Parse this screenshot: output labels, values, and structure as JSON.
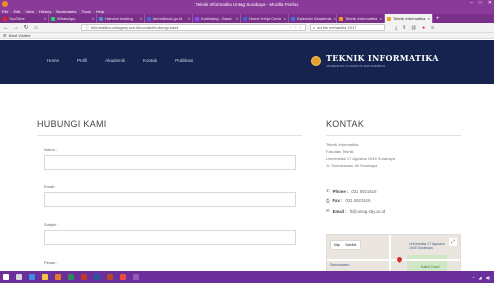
{
  "browser": {
    "window_title": "Teknik Informatika Untag Surabaya - Mozilla Firefox",
    "menu": [
      "File",
      "Edit",
      "View",
      "History",
      "Bookmarks",
      "Tools",
      "Help"
    ],
    "tabs": [
      {
        "label": "YouTube",
        "color": "#e62117"
      },
      {
        "label": "WhatsApp",
        "color": "#25d366"
      },
      {
        "label": "Harvest hosting",
        "color": "#4a90d9"
      },
      {
        "label": "kemdikbud.go.id",
        "color": "#3b6fd4"
      },
      {
        "label": "Kotlinlang - Basic",
        "color": "#7f52ff"
      },
      {
        "label": "Home Kerja Ceria",
        "color": "#3367d6"
      },
      {
        "label": "Kalender Akademik",
        "color": "#3a7bd5"
      },
      {
        "label": "Teknik Informatika",
        "color": "#f0a020"
      },
      {
        "label": "Teknik Informatika",
        "color": "#f0a020",
        "active": true
      }
    ],
    "url": "informatika.untagsby.sch.id/contact/hubungi-kami",
    "search_placeholder": "ad bis mehanika 2017",
    "bookmark_label": "Most Visited"
  },
  "site": {
    "nav": [
      "Home",
      "Profil",
      "Akademik",
      "Kontak",
      "Publikasi"
    ],
    "brand_name": "TEKNIK INFORMATIKA",
    "brand_sub": "UNIVERSITAS 17 AGUSTUS 1945 SURABAYA"
  },
  "page": {
    "heading": "HUBUNGI KAMI",
    "form_labels": [
      "Nama :",
      "Email :",
      "Subjek :",
      "Pesan :"
    ],
    "contact_heading": "KONTAK",
    "address": [
      "Teknik Informatika",
      "Fakultas Teknik",
      "Universitas 17 Agustus 1945 Surabaya",
      "Jl. Semolowaru 45 Surabaya"
    ],
    "phone_label": "Phone :",
    "phone": "031 5921516",
    "fax_label": "Fax :",
    "fax": "031 5921516",
    "email_label": "Email :",
    "email": "ft@untag-sby.ac.id",
    "map": {
      "ctl_map": "Map",
      "ctl_sat": "Satellite",
      "label_campus": "Universitas 17 Agustus 1945 Surabaya",
      "label_area": "Semolowaru",
      "label_place": "Kabul Court"
    }
  },
  "colors": {
    "header_bg": "#15234e",
    "browser_purple": "#8a3a98",
    "taskbar": "#6b2f9b"
  }
}
